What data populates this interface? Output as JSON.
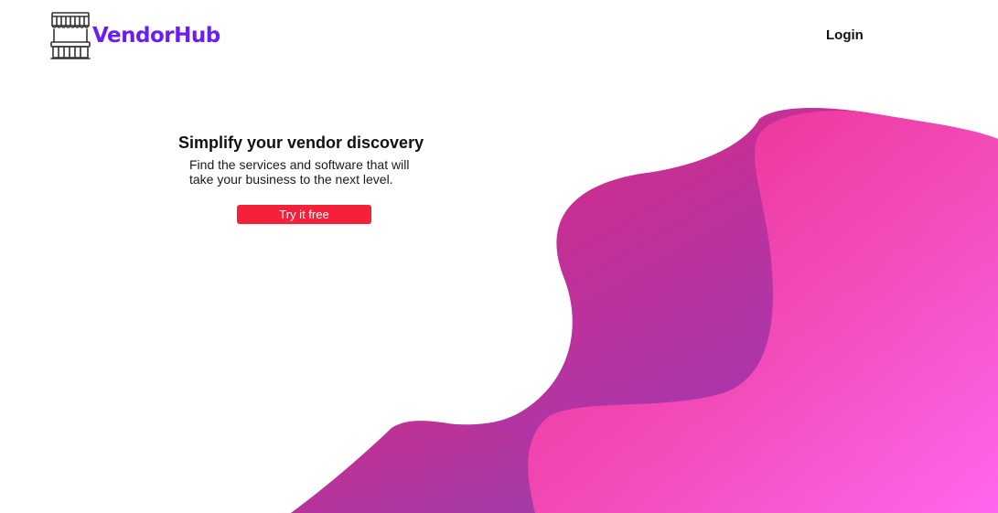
{
  "brand": {
    "name": "VendorHub",
    "color": "#6a1ff0",
    "icon": "market-stall-icon"
  },
  "nav": {
    "login_label": "Login"
  },
  "hero": {
    "title": "Simplify your vendor discovery",
    "subtitle": "Find the services and software that will take your business to the next level.",
    "cta_label": "Try it free",
    "cta_color": "#f5203a"
  },
  "background": {
    "gradient_colors": [
      "#e8288a",
      "#b535a8",
      "#ff5fe0"
    ]
  }
}
